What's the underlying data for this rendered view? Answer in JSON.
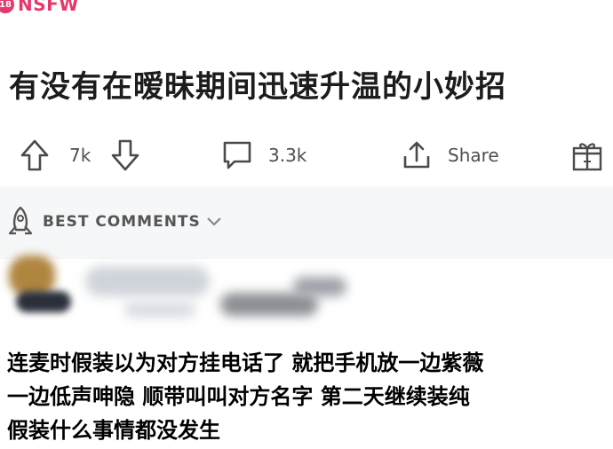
{
  "nsfw": {
    "badge": "18",
    "label": "NSFW"
  },
  "post": {
    "title": "有没有在暧昧期间迅速升温的小妙招"
  },
  "actions": {
    "upvotes": "7k",
    "comments": "3.3k",
    "share": "Share"
  },
  "comments_section": {
    "sort_label": "BEST COMMENTS"
  },
  "caption": {
    "lines": [
      "连麦时假装以为对方挂电话了 就把手机放一边紫薇",
      "一边低声呻隐 顺带叫叫对方名字 第二天继续装纯",
      "假装什么事情都没发生"
    ]
  }
}
